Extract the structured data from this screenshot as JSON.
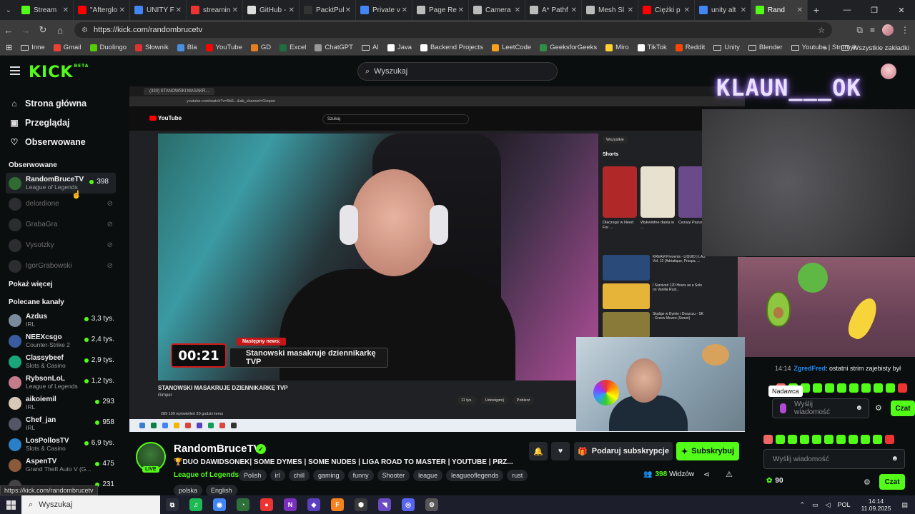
{
  "browser": {
    "tabs": [
      {
        "title": "Stream",
        "color": "#53fc18"
      },
      {
        "title": "\"Afterglo",
        "color": "#f00"
      },
      {
        "title": "UNITY F",
        "color": "#4285f4"
      },
      {
        "title": "streamin",
        "color": "#e33"
      },
      {
        "title": "GitHub -",
        "color": "#ddd"
      },
      {
        "title": "PacktPul",
        "color": "#333"
      },
      {
        "title": "Private v",
        "color": "#4285f4"
      },
      {
        "title": "Page Re",
        "color": "#bbb"
      },
      {
        "title": "Camera",
        "color": "#bbb"
      },
      {
        "title": "A* Pathf",
        "color": "#bbb"
      },
      {
        "title": "Mesh Sl",
        "color": "#bbb"
      },
      {
        "title": "Ciężki p",
        "color": "#f00"
      },
      {
        "title": "unity alt",
        "color": "#4285f4"
      },
      {
        "title": "Rand",
        "color": "#53fc18"
      }
    ],
    "url": "https://kick.com/randombrucetv",
    "bookmarks": [
      {
        "label": "Inne",
        "type": "folder"
      },
      {
        "label": "Gmail",
        "color": "#ea4335"
      },
      {
        "label": "Duolingo",
        "color": "#58cc02"
      },
      {
        "label": "Słownik",
        "color": "#d33"
      },
      {
        "label": "Bla",
        "color": "#4a90e2"
      },
      {
        "label": "YouTube",
        "color": "#f00"
      },
      {
        "label": "GD",
        "color": "#e67e22"
      },
      {
        "label": "Excel",
        "color": "#1d6f42"
      },
      {
        "label": "ChatGPT",
        "color": "#999"
      },
      {
        "label": "AI",
        "type": "folder"
      },
      {
        "label": "Java",
        "color": "#fff"
      },
      {
        "label": "Backend Projects",
        "color": "#fff"
      },
      {
        "label": "LeetCode",
        "color": "#f89f1b"
      },
      {
        "label": "GeeksforGeeks",
        "color": "#2f8d46"
      },
      {
        "label": "Miro",
        "color": "#ffd02f"
      },
      {
        "label": "TikTok",
        "color": "#fff"
      },
      {
        "label": "Reddit",
        "color": "#ff4500"
      },
      {
        "label": "Unity",
        "type": "folder"
      },
      {
        "label": "Blender",
        "type": "folder"
      },
      {
        "label": "Youtube | Strumyk",
        "type": "folder"
      }
    ],
    "other_bookmarks": "Wszystkie zakładki",
    "more_bookmarks": "»"
  },
  "kick": {
    "logo": "KICK",
    "logo_beta": "BETA",
    "search_placeholder": "Wyszukaj",
    "nav": [
      {
        "label": "Strona główna",
        "icon": "home-icon"
      },
      {
        "label": "Przeglądaj",
        "icon": "browse-icon"
      },
      {
        "label": "Obserwowane",
        "icon": "heart-icon"
      }
    ],
    "followed_title": "Obserwowane",
    "followed": [
      {
        "name": "RandomBruceTV",
        "category": "League of Legends",
        "viewers": "398",
        "live": true,
        "color": "#2f6b33"
      },
      {
        "name": "delordione",
        "live": false
      },
      {
        "name": "GrabaGra",
        "live": false
      },
      {
        "name": "Vysotzky",
        "live": false
      },
      {
        "name": "IgorGrabowski",
        "live": false
      }
    ],
    "show_more": "Pokaż więcej",
    "recommended_title": "Polecane kanały",
    "recommended": [
      {
        "name": "Azdus",
        "category": "IRL",
        "viewers": "3,3 tys.",
        "color": "#7a8b9c"
      },
      {
        "name": "NEEXcsgo",
        "category": "Counter-Strike 2",
        "viewers": "2,4 tys.",
        "color": "#3a5ba0"
      },
      {
        "name": "Classybeef",
        "category": "Slots & Casino",
        "viewers": "2,9 tys.",
        "color": "#1aa67a"
      },
      {
        "name": "RybsonLoL",
        "category": "League of Legends",
        "viewers": "1,2 tys.",
        "color": "#c47b8a"
      },
      {
        "name": "aikoiemil",
        "category": "IRL",
        "viewers": "293",
        "color": "#d8c8b8"
      },
      {
        "name": "Chef_jan",
        "category": "IRL",
        "viewers": "958",
        "color": "#556"
      },
      {
        "name": "LosPollosTV",
        "category": "Slots & Casino",
        "viewers": "6,9 tys.",
        "color": "#2a7fc8"
      },
      {
        "name": "AspenTV",
        "category": "Grand Theft Auto V (G...",
        "viewers": "475",
        "color": "#8a5a3a"
      },
      {
        "name": "",
        "category": "",
        "viewers": "231",
        "color": "#444"
      }
    ]
  },
  "video": {
    "inner_tab": "(320) STANOWSKI MASAKR...",
    "inner_url": "youtube.com/watch?v=5bE...&ab_channel=Gimper",
    "yt_logo": "YouTube",
    "yt_search": "Szukaj",
    "timer": "00:21",
    "news_tag": "Następny news:",
    "news_text": "Stanowski masakruje dziennikarkę TVP",
    "video_title": "STANOWSKI MASAKRUJE DZIENNIKARKĘ TVP",
    "channel": "Gimper",
    "actions": [
      "11 tys.",
      "Udostępnij",
      "Pobierz"
    ],
    "views": "289 199 wyświetleń  20 godzin temu",
    "chip": "Wszystkie",
    "shorts_label": "Shorts",
    "shorts": [
      {
        "caption": "Dlaczego w Need For ...",
        "color": "#b02828"
      },
      {
        "caption": "Wykwintne dania w ...",
        "color": "#e9e1d0"
      },
      {
        "caption": "Cezary Pazura ...",
        "color": "#6a4a8a"
      }
    ],
    "recommended": [
      {
        "title": "KREAM Presents - LIQUID | LAB Vol. 12 (Adriatique, Prospa, ...",
        "color": "#2a4a7a"
      },
      {
        "title": "I Survived 120 Hours as a Solo on Vanilla Rust...",
        "color": "#e7b43a"
      },
      {
        "title": "Skalige w Dymie i Deszczu - SK - Grzew Mozzo (Sweet)",
        "color": "#8a7a3a"
      }
    ],
    "overlay_text": "KLAUN___OK"
  },
  "chat": {
    "message": {
      "time": "14:14",
      "user": "ZgredFred",
      "text": ": ostatni strim zajebisty był"
    },
    "tooltip": "Nadawca",
    "input1_placeholder": "Wyślij wiadomość",
    "send1": "Czat",
    "input2_placeholder": "Wyślij wiadomość",
    "points": "90",
    "send2": "Czat"
  },
  "stream": {
    "streamer": "RandomBruceTV",
    "live": "LIVE",
    "title": "🏆DUO DAWIDSONEK| SOME DYMES | SOME NUDES | LIGA ROAD TO MASTER | YOUTUBE | PRZ...",
    "category": "League of Legends",
    "tags": [
      "Polish",
      "irl",
      "chill",
      "gaming",
      "funny",
      "Shooter",
      "league",
      "leagueoflegends",
      "rust"
    ],
    "tags2": [
      "polska",
      "English"
    ],
    "gift_label": "Podaruj subskrypcje",
    "sub_label": "Subskrybuj",
    "viewers": "398",
    "viewers_label": "Widzów"
  },
  "status_url": "https://kick.com/randombrucetv",
  "taskbar": {
    "search": "Wyszukaj",
    "lang": "POL",
    "time": "14:14",
    "date": "11.09.2025",
    "apps": [
      {
        "label": "⧉",
        "color": "#2b2f3a"
      },
      {
        "label": "♫",
        "color": "#1db954"
      },
      {
        "label": "◉",
        "color": "#4285f4"
      },
      {
        "label": "◔",
        "color": "#2f6f3a"
      },
      {
        "label": "●",
        "color": "#e33"
      },
      {
        "label": "N",
        "color": "#7a2fbf"
      },
      {
        "label": "◆",
        "color": "#5a3fbf"
      },
      {
        "label": "F",
        "color": "#f58220"
      },
      {
        "label": "⬢",
        "color": "#3a3a3a"
      },
      {
        "label": "◥",
        "color": "#6a4bc3"
      },
      {
        "label": "◎",
        "color": "#5865f2"
      },
      {
        "label": "⚙",
        "color": "#555"
      }
    ]
  },
  "colors": {
    "kick_green": "#53fc18",
    "chat_user": "#1e90ff",
    "bg": "#0b0e0f"
  }
}
